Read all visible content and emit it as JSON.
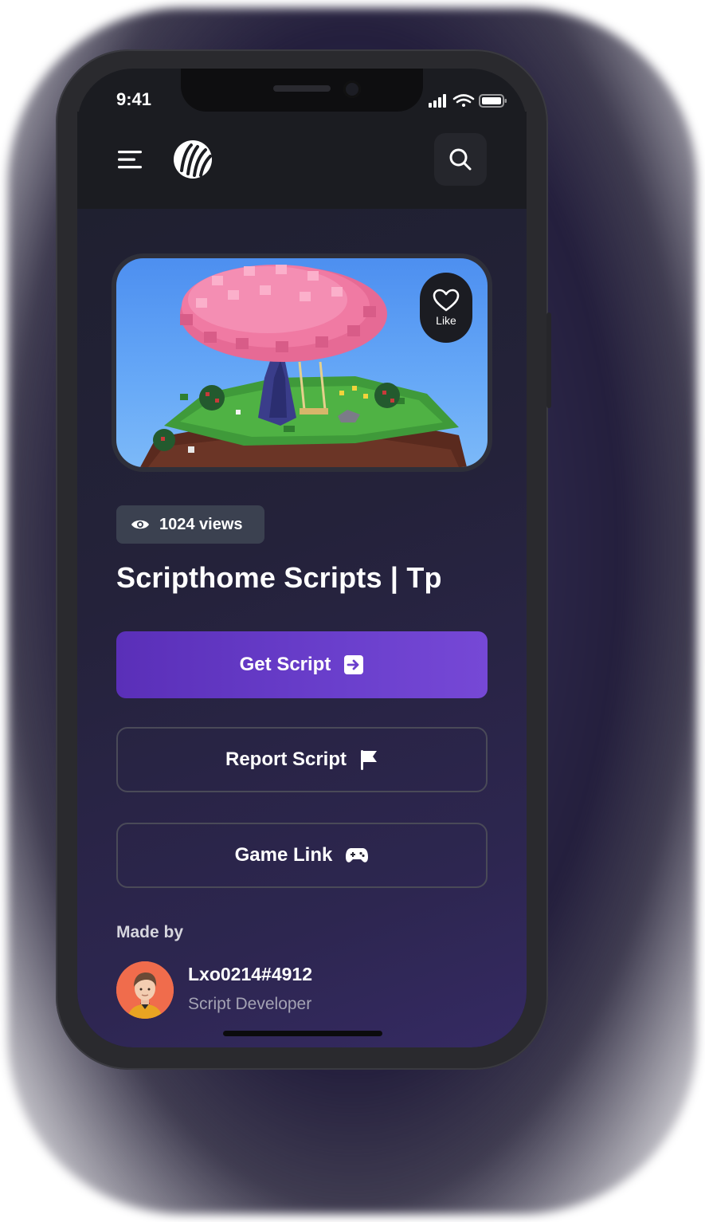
{
  "status_bar": {
    "time": "9:41",
    "icons": [
      "signal-icon",
      "wifi-icon",
      "battery-icon"
    ]
  },
  "header": {
    "menu_icon": "menu-icon",
    "logo": "app-logo",
    "search_icon": "search-icon"
  },
  "hero": {
    "like_label": "Like",
    "like_icon": "heart-icon"
  },
  "stats": {
    "views": "1024 views",
    "icon": "eye-icon"
  },
  "script": {
    "title": "Scripthome Scripts | Tp"
  },
  "actions": {
    "get_script": "Get Script",
    "report_script": "Report Script",
    "game_link": "Game Link"
  },
  "author": {
    "section_label": "Made by",
    "name": "Lxo0214#4912",
    "role": "Script Developer"
  },
  "colors": {
    "primary": "#6a3fcc",
    "background": "#1b1c21",
    "badge": "#3b4150",
    "avatar_bg": "#f06c4c"
  }
}
